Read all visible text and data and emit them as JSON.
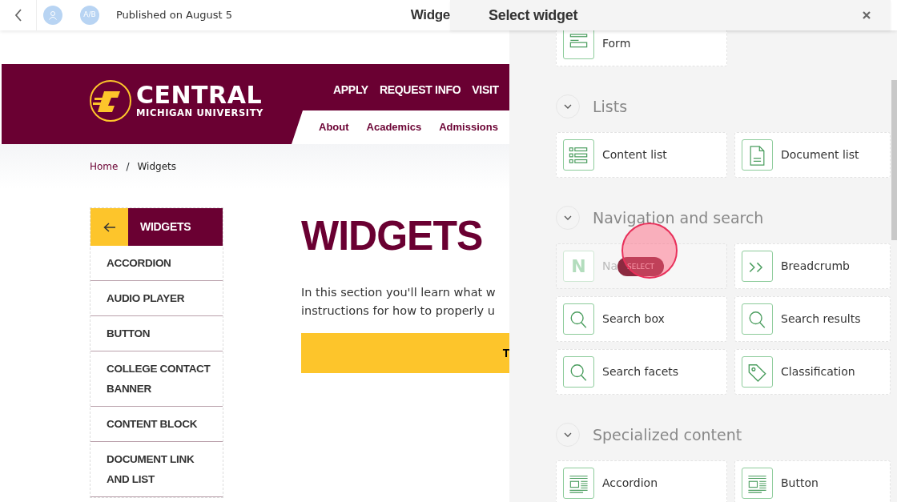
{
  "topbar": {
    "avatar_initials": "A/B",
    "published": "Published on August 5",
    "page_title": "Widge"
  },
  "site": {
    "logo_title": "CENTRAL",
    "logo_subtitle": "MICHIGAN UNIVERSITY",
    "utility_nav": [
      "APPLY",
      "REQUEST INFO",
      "VISIT"
    ],
    "main_nav": [
      "About",
      "Academics",
      "Admissions"
    ]
  },
  "breadcrumb": [
    {
      "label": "Home",
      "kind": "link"
    },
    {
      "label": "/",
      "kind": "separator"
    },
    {
      "label": "Widgets",
      "kind": "current"
    }
  ],
  "sidebar": {
    "title": "WIDGETS",
    "items": [
      "ACCORDION",
      "AUDIO PLAYER",
      "BUTTON",
      "COLLEGE CONTACT BANNER",
      "CONTENT BLOCK",
      "DOCUMENT LINK AND LIST"
    ]
  },
  "heading": "WIDGETS",
  "intro_lines": [
    "In this section you'll learn what w",
    "instructions for how to properly u"
  ],
  "cta_button": "T",
  "panel": {
    "title": "Select widget",
    "sections": [
      {
        "widgets": [
          {
            "label": "Form",
            "kind": "form",
            "hovered": false
          }
        ]
      },
      {
        "title": "Lists",
        "widgets": [
          {
            "label": "Content list",
            "kind": "list",
            "hovered": false
          },
          {
            "label": "Document list",
            "kind": "document",
            "hovered": false
          }
        ]
      },
      {
        "title": "Navigation and search",
        "widgets": [
          {
            "label": "Na",
            "kind": "letter",
            "glyph": "N",
            "hovered": true,
            "hover_button": "SELECT"
          },
          {
            "label": "Breadcrumb",
            "kind": "breadcrumb",
            "hovered": false
          },
          {
            "label": "Search box",
            "kind": "search",
            "hovered": false
          },
          {
            "label": "Search results",
            "kind": "search",
            "hovered": false
          },
          {
            "label": "Search facets",
            "kind": "search",
            "hovered": false
          },
          {
            "label": "Classification",
            "kind": "tag",
            "hovered": false
          }
        ]
      },
      {
        "title": "Specialized content",
        "widgets": [
          {
            "label": "Accordion",
            "kind": "article",
            "hovered": false
          },
          {
            "label": "Button",
            "kind": "article",
            "hovered": false
          }
        ]
      }
    ]
  }
}
